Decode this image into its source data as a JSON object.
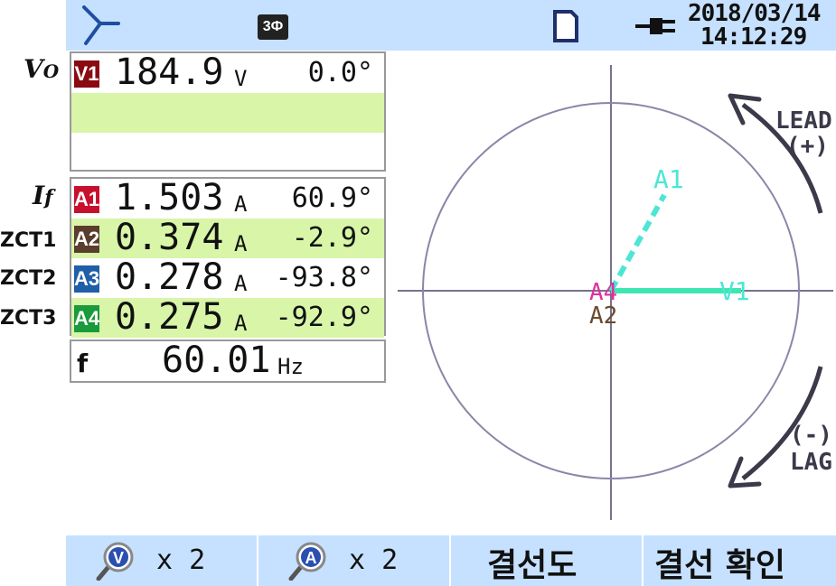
{
  "status": {
    "date": "2018/03/14",
    "time": "14:12:29",
    "badge": "3Ф"
  },
  "annotations": {
    "v0": "V",
    "v0_sub": "O",
    "if": "I",
    "if_sub": "f",
    "zct1": "ZCT1",
    "zct2": "ZCT2",
    "zct3": "ZCT3"
  },
  "voltage": {
    "badge": "V1",
    "value": "184.9",
    "unit": "V",
    "angle": "0.0°"
  },
  "currents": [
    {
      "badge": "A1",
      "value": "1.503",
      "unit": "A",
      "angle": "60.9°",
      "color": "#c8102e"
    },
    {
      "badge": "A2",
      "value": "0.374",
      "unit": "A",
      "angle": "-2.9°",
      "color": "#5a3d2b"
    },
    {
      "badge": "A3",
      "value": "0.278",
      "unit": "A",
      "angle": "-93.8°",
      "color": "#1f5fa8"
    },
    {
      "badge": "A4",
      "value": "0.275",
      "unit": "A",
      "angle": "-92.9°",
      "color": "#1a9a3a"
    }
  ],
  "frequency": {
    "label": "f",
    "value": "60.01",
    "unit": "Hz"
  },
  "phasor": {
    "lead_label": "LEAD",
    "lead_sign": "(+)",
    "lag_label": "LAG",
    "lag_sign": "(-)",
    "labels": {
      "v1": "V1",
      "a1": "A1",
      "a2": "A2",
      "a4": "A4"
    },
    "colors": {
      "v1": "#3ee6b0",
      "a1": "#4de6d6",
      "a2": "#6b4a2e",
      "a4": "#e030a0",
      "circle": "#8a86a8",
      "axis": "#77728f"
    }
  },
  "buttons": {
    "v_zoom": "x 2",
    "a_zoom": "x 2",
    "wiring": "결선도",
    "wiring_check": "결선 확인",
    "v_icon": "V",
    "a_icon": "A"
  }
}
